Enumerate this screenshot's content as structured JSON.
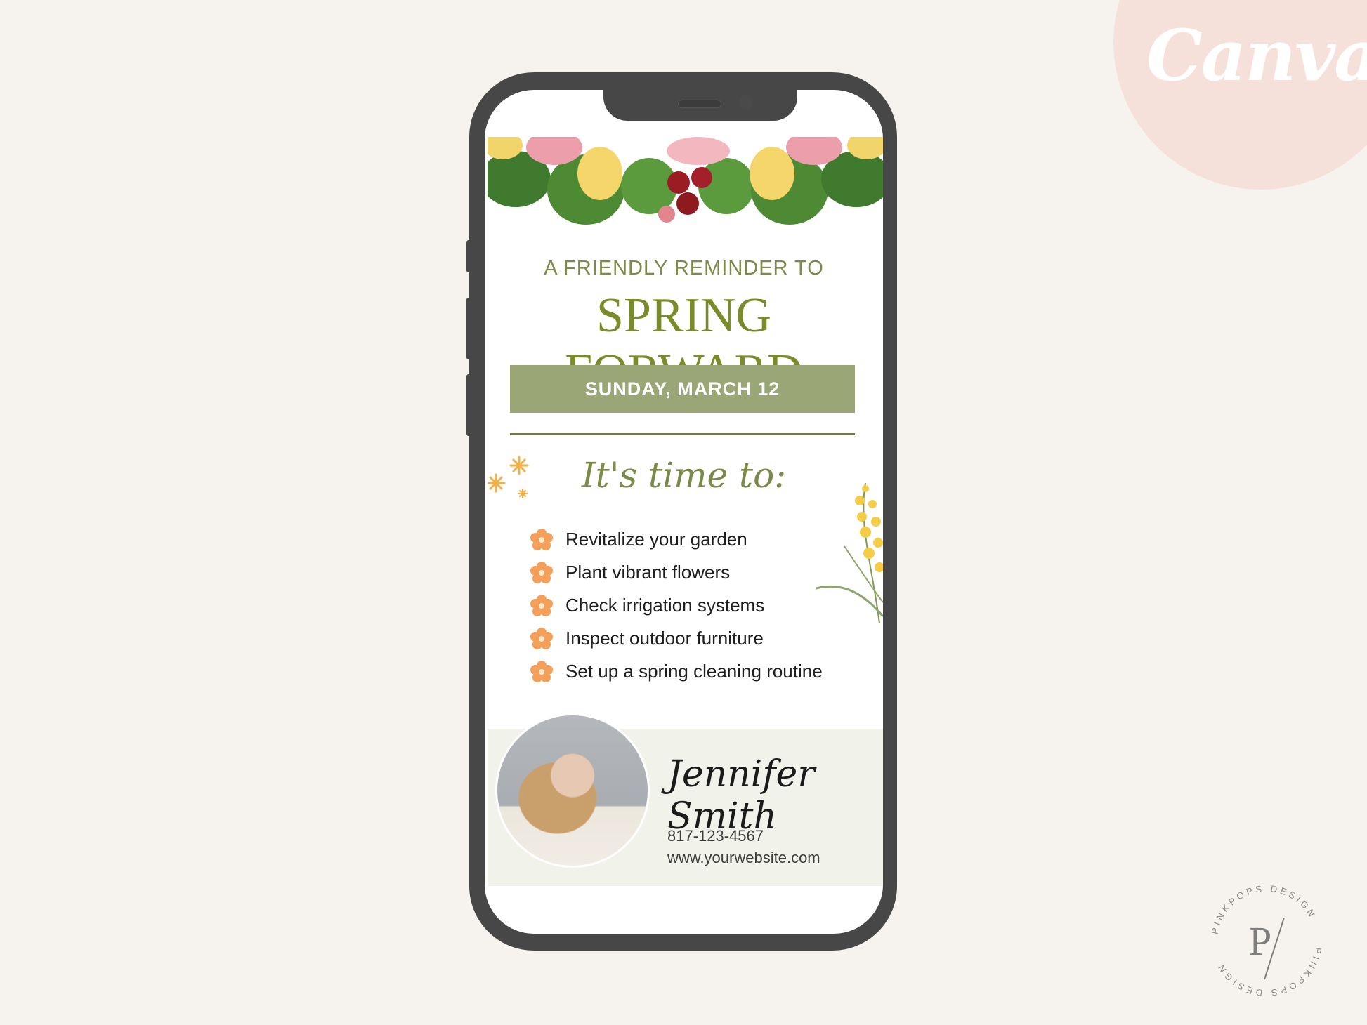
{
  "badge": {
    "text": "Canva",
    "color": "#f5e1da"
  },
  "card": {
    "subtitle": "A FRIENDLY REMINDER TO",
    "title": "SPRING FORWARD",
    "date": "SUNDAY, MARCH 12",
    "script_heading": "It's time to:",
    "list": [
      "Revitalize your garden",
      "Plant vibrant flowers",
      "Check irrigation systems",
      "Inspect outdoor furniture",
      "Set up a spring cleaning routine"
    ],
    "contact": {
      "name": "Jennifer Smith",
      "phone": "817-123-4567",
      "website": "www.yourwebsite.com"
    }
  },
  "logo": {
    "ring_text": "PINKPOPS DESIGN",
    "monogram": "P"
  },
  "colors": {
    "accent_green": "#7a8c2a",
    "date_bar": "#9aa675",
    "bullet_orange": "#f4a05a",
    "phone_frame": "#474747",
    "background": "#f6f3ef"
  }
}
